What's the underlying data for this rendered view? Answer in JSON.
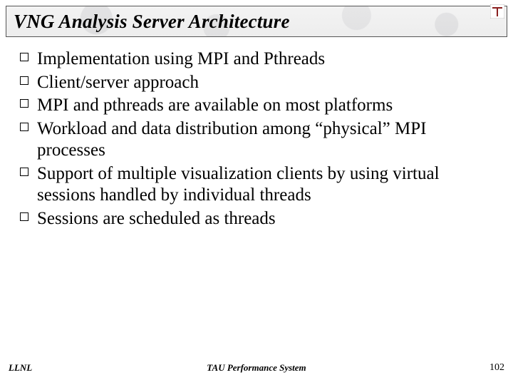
{
  "slide": {
    "title": "VNG Analysis Server Architecture",
    "bullets": [
      "Implementation using MPI and Pthreads",
      "Client/server approach",
      "MPI and pthreads are available on most platforms",
      "Workload and data distribution among “physical” MPI processes",
      "Support of multiple visualization clients by using virtual sessions handled by individual threads",
      "Sessions are scheduled as threads"
    ]
  },
  "footer": {
    "left": "LLNL",
    "center": "TAU Performance System",
    "page_number": "102"
  },
  "logo": {
    "name": "tau-logo"
  }
}
